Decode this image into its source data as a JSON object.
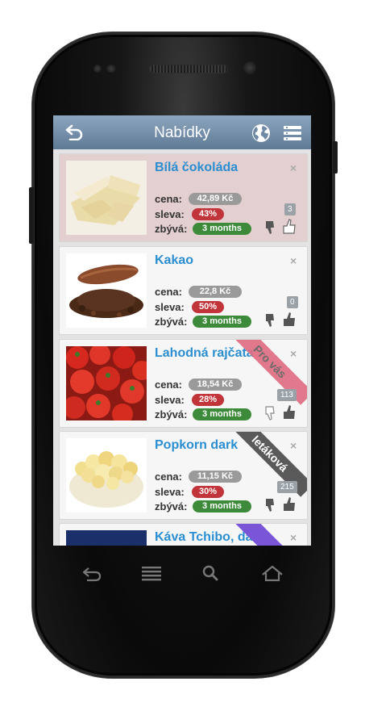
{
  "header": {
    "title": "Nabídky"
  },
  "items": [
    {
      "name": "Bílá čokoláda",
      "price_label": "cena:",
      "price": "42,89 Kč",
      "disc_label": "sleva:",
      "disc": "43%",
      "time_label": "zbývá:",
      "time": "3 months",
      "count": "3",
      "ribbon": ""
    },
    {
      "name": "Kakao",
      "price_label": "cena:",
      "price": "22,8 Kč",
      "disc_label": "sleva:",
      "disc": "50%",
      "time_label": "zbývá:",
      "time": "3 months",
      "count": "0",
      "ribbon": ""
    },
    {
      "name": "Lahodná rajčata",
      "price_label": "cena:",
      "price": "18,54 Kč",
      "disc_label": "sleva:",
      "disc": "28%",
      "time_label": "zbývá:",
      "time": "3 months",
      "count": "113",
      "ribbon": "Pro vás"
    },
    {
      "name": "Popkorn dark",
      "price_label": "cena:",
      "price": "11,15 Kč",
      "disc_label": "sleva:",
      "disc": "30%",
      "time_label": "zbývá:",
      "time": "3 months",
      "count": "215",
      "ribbon": "letáková"
    },
    {
      "name": "Káva Tchibo, dát to"
    }
  ],
  "icons": {
    "back": "back-arrow-icon",
    "globe": "globe-icon",
    "menu": "menu-list-icon",
    "close": "close-icon",
    "thumb_down": "thumb-down-icon",
    "thumb_up": "thumb-up-icon"
  },
  "close_glyph": "×",
  "colors": {
    "header": "#6f89a6",
    "name": "#2a8ed0",
    "price": "#9a9a9a",
    "discount": "#c0343a",
    "time": "#3d8a3a",
    "ribbon_pink": "#e06a80",
    "ribbon_gray": "#5a5a5a",
    "ribbon_purple": "#7a55d8"
  }
}
